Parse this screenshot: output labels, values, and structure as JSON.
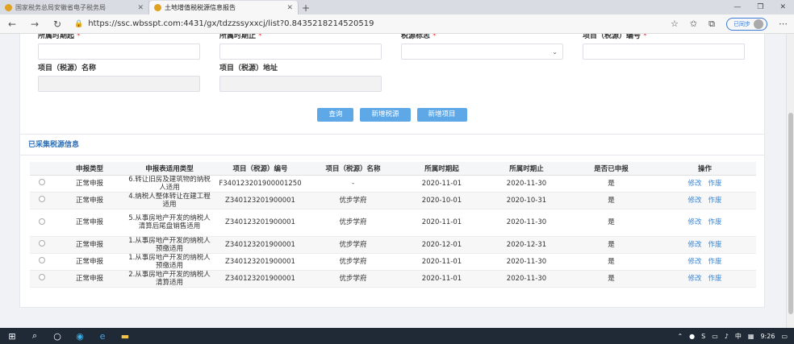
{
  "browser": {
    "tabs": [
      {
        "title": "国家税务总局安徽省电子税务局",
        "active": false
      },
      {
        "title": "土地增值税税源信息报告",
        "active": true
      }
    ],
    "url": "https://ssc.wbsspt.com:4431/gx/tdzzssyxxcj/list?0.8435218214520519",
    "profile_label": "已同步"
  },
  "form": {
    "fields": [
      {
        "label": "所属时期起",
        "required": true,
        "value": "",
        "type": "text"
      },
      {
        "label": "所属时期止",
        "required": true,
        "value": "",
        "type": "text"
      },
      {
        "label": "税源标志",
        "required": true,
        "value": "",
        "type": "select"
      },
      {
        "label": "项目（税源）编号",
        "required": true,
        "value": "",
        "type": "text"
      },
      {
        "label": "项目（税源）名称",
        "required": false,
        "value": "",
        "type": "text"
      },
      {
        "label": "项目（税源）地址",
        "required": false,
        "value": "",
        "type": "text"
      }
    ],
    "required_mark": "*",
    "buttons": {
      "query": "查询",
      "add_source": "新增税源",
      "add_project": "新增项目"
    }
  },
  "list": {
    "title": "已采集税源信息",
    "columns": [
      "",
      "申报类型",
      "申报表适用类型",
      "项目（税源）编号",
      "项目（税源）名称",
      "所属时期起",
      "所属时期止",
      "是否已申报",
      "操作"
    ],
    "action_edit": "修改",
    "action_void": "作废",
    "rows": [
      {
        "type": "正常申报",
        "form_type": "6.转让旧房及建筑物的纳税人适用",
        "code": "F340123201900001250",
        "name": "-",
        "start": "2020-11-01",
        "end": "2020-11-30",
        "declared": "是"
      },
      {
        "type": "正常申报",
        "form_type": "4.纳税人整体转让在建工程适用",
        "code": "Z340123201900001",
        "name": "优步学府",
        "start": "2020-10-01",
        "end": "2020-10-31",
        "declared": "是"
      },
      {
        "type": "正常申报",
        "form_type": "5.从事房地产开发的纳税人清算后尾盘销售适用",
        "code": "Z340123201900001",
        "name": "优步学府",
        "start": "2020-11-01",
        "end": "2020-11-30",
        "declared": "是"
      },
      {
        "type": "正常申报",
        "form_type": "1.从事房地产开发的纳税人预缴适用",
        "code": "Z340123201900001",
        "name": "优步学府",
        "start": "2020-12-01",
        "end": "2020-12-31",
        "declared": "是"
      },
      {
        "type": "正常申报",
        "form_type": "1.从事房地产开发的纳税人预缴适用",
        "code": "Z340123201900001",
        "name": "优步学府",
        "start": "2020-11-01",
        "end": "2020-11-30",
        "declared": "是"
      },
      {
        "type": "正常申报",
        "form_type": "2.从事房地产开发的纳税人清算适用",
        "code": "Z340123201900001",
        "name": "优步学府",
        "start": "2020-11-01",
        "end": "2020-11-30",
        "declared": "是"
      }
    ]
  },
  "taskbar": {
    "tray_ime": "中",
    "tray_s": "S",
    "time": "9:26"
  }
}
